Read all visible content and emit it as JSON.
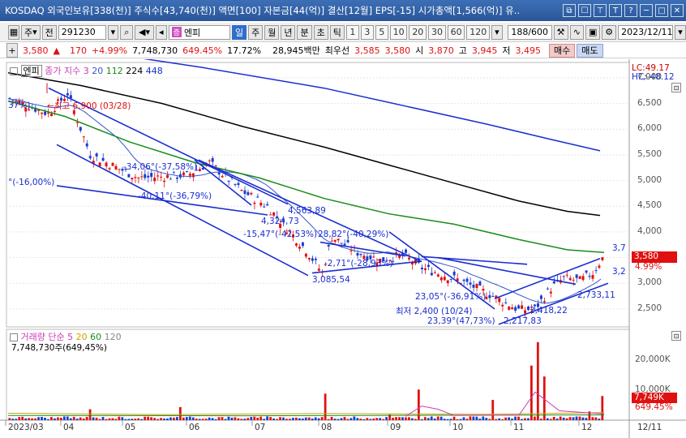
{
  "window": {
    "title": "KOSDAQ 외국인보유[338(천)] 주식수[43,740(천)] 액면[100] 자본금[44(억)] 결산[12월] EPS[-15] 시가총액[1,566(억)] 유..",
    "buttons": [
      "⧉",
      "☐",
      "⊤",
      "T",
      "?",
      "─",
      "□",
      "✕"
    ]
  },
  "toolbar": {
    "market": "주",
    "prev": "전",
    "code": "291230",
    "name": "엔피",
    "name_tag": "증",
    "periods": [
      "일",
      "주",
      "월",
      "년",
      "분",
      "초",
      "틱"
    ],
    "numbers": [
      "1",
      "3",
      "5",
      "10",
      "20",
      "30",
      "60",
      "120"
    ],
    "page_count": "188/600",
    "date": "2023/12/11"
  },
  "info": {
    "price": "3,580",
    "change_arrow": "▲",
    "change": "170",
    "change_pct": "+4.99%",
    "volume": "7,748,730",
    "volume_pct": "649.45%",
    "turnover": "17.72%",
    "trade_value": "28,945백만",
    "priority_label": "최우선",
    "bid1": "3,585",
    "ask1": "3,580",
    "open_label": "시",
    "open": "3,870",
    "high_label": "고",
    "high": "3,945",
    "low_label": "저",
    "low": "3,495",
    "buy": "매수",
    "sell": "매도"
  },
  "price_panel": {
    "name": "엔피",
    "legend_title": "종가 지수 3",
    "ma_labels": [
      "20",
      "112",
      "224",
      "448"
    ],
    "lc": "LC:49.17",
    "hc": "HC:-48.12",
    "y_ticks": [
      "7,000",
      "6,500",
      "6,000",
      "5,500",
      "5,000",
      "4,500",
      "4,000",
      "3,500",
      "3,000",
      "2,500"
    ],
    "current_price_tag": "3,580",
    "current_pct_tag": "4.99%",
    "annotations": {
      "high_note": "←최고 6,900 (03/28)",
      "left_pct": "37%)",
      "left_pct2": "°(-16,00%)",
      "a1": "-34,06°(-37,58%)",
      "a2": "-40,11°(-36,79%)",
      "a3": "4,563,89",
      "a4": "4,324,73",
      "a5": "-15,47°(-42,53%)",
      "a6": "28,82°(-40,29%)",
      "a7": "-2,71°(-28,93%)",
      "a8": "3,085,54",
      "a9": "23,05°(-36,91%)",
      "a10": "최저 2,400 (10/24)",
      "a11": "23,39°(47,73%)",
      "a12": "2,217,83",
      "a13": "2,418,22",
      "a14": "2,733,11",
      "a15": "3,7",
      "a16": "3,2"
    }
  },
  "volume_panel": {
    "legend_title": "거래량",
    "legend_sub": "단순",
    "ma_labels": [
      "5",
      "20",
      "60",
      "120"
    ],
    "volume_text": "7,748,730주(649,45%)",
    "y_ticks": [
      "20,000K",
      "10,000K"
    ],
    "current_tag": "7,749K",
    "current_pct": "649.45%"
  },
  "x_axis": {
    "labels": [
      "2023/03",
      "04",
      "05",
      "06",
      "07",
      "08",
      "09",
      "10",
      "11",
      "12"
    ],
    "end_label": "12/11"
  },
  "colors": {
    "ma20": "#3355cc",
    "ma112": "#1a8c1a",
    "ma224": "#000000",
    "ma448": "#1a2dd0",
    "up": "#e01010",
    "down": "#1a3dd0",
    "trend": "#1a2dd0"
  }
}
